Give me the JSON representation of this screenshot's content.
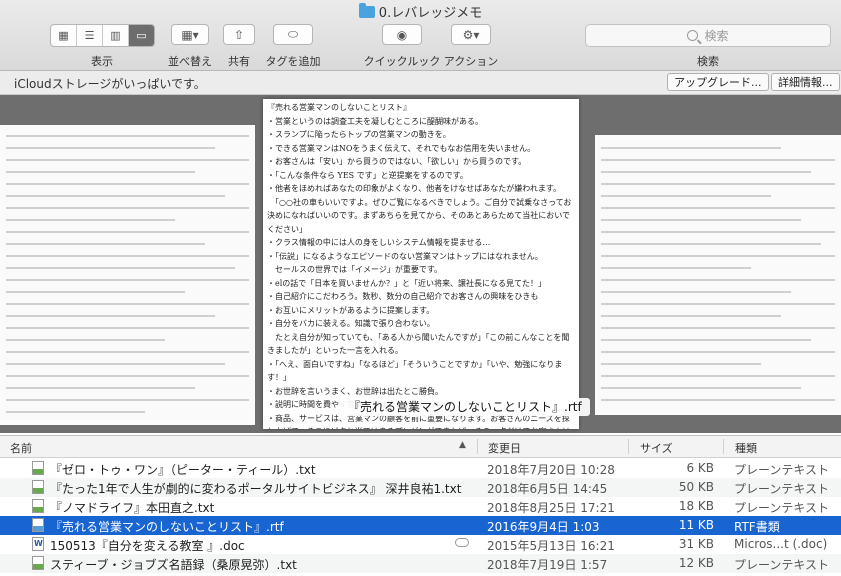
{
  "window": {
    "title": "0.レバレッジメモ"
  },
  "toolbar": {
    "view_label": "表示",
    "arrange_label": "並べ替え",
    "share_label": "共有",
    "tags_label": "タグを追加",
    "quicklook_label": "クイックルック",
    "action_label": "アクション",
    "search_placeholder": "検索",
    "search_label": "検索"
  },
  "banner": {
    "message": "iCloudストレージがいっぱいです。",
    "upgrade_button": "アップグレード...",
    "details_button": "詳細情報..."
  },
  "preview": {
    "caption": "『売れる営業マンのしないことリスト』.rtf",
    "text": "『売れる営業マンのしないことリスト』\n・営業というのは調査工夫を凝しむところに醍醐味がある。\n・スランプに陥ったらトップの営業マンの動きを。\n・できる営業マンはNOをうまく伝えて、それでもなお信用を失いません。\n・お客さんは「安い」から買うのではない、「欲しい」から買うのです。\n・「こんな条件なら YES です」と逆提案をするのです。\n・他者をほめればあなたの印象がよくなり、他者をけなせばあなたが嫌われます。\n　「○○社の車もいいですよ。ぜひご覧になるべきでしょう。ご自分で試乗なさってお決めになればいいのです。まずあちらを見てから、そのあとあらためて当社においでください」\n・クラス情報の中には人の身をしいシステム情報を提ませる…\n・「伝説」になるようなエピソードのない営業マンはトップにはなれません。\n　セールスの世界では「イメージ」が重要です。\n・elの話で「日本を買いませんか？」と「近い将来、譲社長になる見てた！」\n・自己紹介にこだわろう。数秒、数分の自己紹介でお客さんの興味をひきも\n・お互いにメリットがあるように提案します。\n・自分をバカに装える。知識で張り合わない。\n　たとえ自分が知っていても、「ある人から聞いたんですが」「この前こんなことを聞きましたが」といった一言を入れる。\n・「へえ、面白いですね」「なるほど」「そういうことですか」「いや、勉強になります！」\n・お世辞を言いうまく、お世辞は出たとこ勝負。\n・説明に時間を費やす営業マンは成果が上がらない。\n・商品、サービスは、営業マンの顧客を前に重要になります。お客さんのニーズを探し上げて、そこにピタと当てはまるプレゼンができれば、その一点だけでお客さんは「買おう」となります。\n　あなたが知\n・結論を先送"
  },
  "columns": {
    "name": "名前",
    "modified": "変更日",
    "size": "サイズ",
    "kind": "種類"
  },
  "files": [
    {
      "name": "『ゼロ・トゥ・ワン』（ピーター・ティール）.txt",
      "date": "2018年7月20日 10:28",
      "size": "6 KB",
      "kind": "プレーンテキスト",
      "icon": "txt-file-icon"
    },
    {
      "name": "『たった1年で人生が劇的に変わるポータルサイトビジネス』 深井良祐1.txt",
      "date": "2018年6月5日 14:45",
      "size": "50 KB",
      "kind": "プレーンテキスト",
      "icon": "txt-file-icon"
    },
    {
      "name": "『ノマドライフ』本田直之.txt",
      "date": "2018年8月25日 17:21",
      "size": "18 KB",
      "kind": "プレーンテキスト",
      "icon": "txt-file-icon"
    },
    {
      "name": "『売れる営業マンのしないことリスト』.rtf",
      "date": "2016年9月4日 1:03",
      "size": "11 KB",
      "kind": "RTF書類",
      "icon": "rtf-file-icon",
      "selected": true
    },
    {
      "name": "150513『自分を変える教室 』.doc",
      "date": "2015年5月13日 16:21",
      "size": "31 KB",
      "kind": "Micros...t (.doc)",
      "icon": "doc-file-icon",
      "cloud": true
    },
    {
      "name": "スティーブ・ジョブズ名語録（桑原晃弥）.txt",
      "date": "2018年7月19日 1:57",
      "size": "12 KB",
      "kind": "プレーンテキスト",
      "icon": "txt-file-icon"
    }
  ],
  "colors": {
    "selection": "#1865d2",
    "folder": "#4aa3df"
  }
}
